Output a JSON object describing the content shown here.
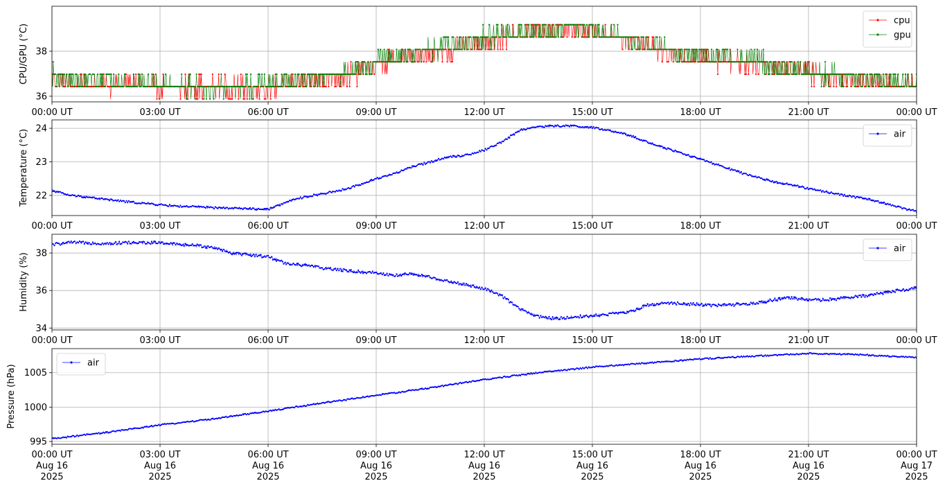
{
  "chart_data": [
    {
      "type": "line",
      "ylabel": "CPU/GPU (°C)",
      "ylim": [
        35.75,
        40.0
      ],
      "yticks": [
        36,
        38
      ],
      "xlabels": [
        "00:00 UT",
        "03:00 UT",
        "06:00 UT",
        "09:00 UT",
        "12:00 UT",
        "15:00 UT",
        "18:00 UT",
        "21:00 UT",
        "00:00 UT"
      ],
      "xlim_hours": [
        0,
        24
      ],
      "grid": true,
      "legend": "top-right",
      "series": [
        {
          "name": "cpu",
          "color": "#ff0000",
          "x_hours": [
            0,
            0.5,
            1,
            1.5,
            2,
            2.5,
            3,
            3.5,
            4,
            4.5,
            5,
            5.5,
            6,
            6.5,
            7,
            7.5,
            8,
            8.5,
            9,
            9.5,
            10,
            10.5,
            11,
            11.5,
            12,
            12.5,
            13,
            13.5,
            14,
            14.5,
            15,
            15.5,
            16,
            16.5,
            17,
            17.5,
            18,
            18.5,
            19,
            19.5,
            20,
            20.5,
            21,
            21.5,
            22,
            22.5,
            23,
            23.5,
            24
          ],
          "values": [
            36.9,
            36.5,
            36.5,
            36.5,
            36.5,
            36.5,
            36.4,
            36.4,
            36.4,
            36.4,
            36.4,
            36.4,
            36.4,
            36.5,
            36.6,
            36.8,
            36.9,
            37.0,
            37.4,
            37.6,
            37.7,
            37.9,
            38.0,
            38.2,
            38.4,
            38.6,
            38.8,
            38.9,
            39.0,
            39.0,
            38.9,
            38.7,
            38.5,
            38.2,
            38.0,
            37.8,
            37.7,
            37.6,
            37.5,
            37.5,
            37.3,
            37.2,
            37.0,
            36.9,
            36.8,
            36.7,
            36.6,
            36.5,
            36.5
          ],
          "noise": 0.35
        },
        {
          "name": "gpu",
          "color": "#008000",
          "x_hours": [
            0,
            0.5,
            1,
            1.5,
            2,
            2.5,
            3,
            3.5,
            4,
            4.5,
            5,
            5.5,
            6,
            6.5,
            7,
            7.5,
            8,
            8.5,
            9,
            9.5,
            10,
            10.5,
            11,
            11.5,
            12,
            12.5,
            13,
            13.5,
            14,
            14.5,
            15,
            15.5,
            16,
            16.5,
            17,
            17.5,
            18,
            18.5,
            19,
            19.5,
            20,
            20.5,
            21,
            21.5,
            22,
            22.5,
            23,
            23.5,
            24
          ],
          "values": [
            37.0,
            36.7,
            36.7,
            36.7,
            36.6,
            36.5,
            36.5,
            36.5,
            36.4,
            36.4,
            36.4,
            36.4,
            36.5,
            36.6,
            36.8,
            36.9,
            37.0,
            37.1,
            37.6,
            37.8,
            38.0,
            38.1,
            38.2,
            38.4,
            38.6,
            38.7,
            38.9,
            39.0,
            39.1,
            39.1,
            39.0,
            38.8,
            38.6,
            38.3,
            38.1,
            37.9,
            37.8,
            37.7,
            37.6,
            37.6,
            37.4,
            37.3,
            37.1,
            37.0,
            36.9,
            36.8,
            36.7,
            36.6,
            36.5
          ],
          "noise": 0.35
        }
      ]
    },
    {
      "type": "line",
      "ylabel": "Temperature (°C)",
      "ylim": [
        21.4,
        24.25
      ],
      "yticks": [
        22,
        23,
        24
      ],
      "xlabels": [
        "00:00 UT",
        "03:00 UT",
        "06:00 UT",
        "09:00 UT",
        "12:00 UT",
        "15:00 UT",
        "18:00 UT",
        "21:00 UT",
        "00:00 UT"
      ],
      "xlim_hours": [
        0,
        24
      ],
      "grid": true,
      "legend": "top-right",
      "series": [
        {
          "name": "air",
          "color": "#0000ff",
          "x_hours": [
            0,
            0.5,
            1,
            1.5,
            2,
            2.5,
            3,
            3.5,
            4,
            4.5,
            5,
            5.5,
            6,
            6.5,
            7,
            7.5,
            8,
            8.5,
            9,
            9.5,
            10,
            10.5,
            11,
            11.5,
            12,
            12.5,
            13,
            13.5,
            14,
            14.5,
            15,
            15.5,
            16,
            16.5,
            17,
            17.5,
            18,
            18.5,
            19,
            19.5,
            20,
            20.5,
            21,
            21.5,
            22,
            22.5,
            23,
            23.5,
            24
          ],
          "values": [
            22.15,
            22.0,
            21.95,
            21.88,
            21.82,
            21.77,
            21.72,
            21.68,
            21.66,
            21.63,
            21.62,
            21.6,
            21.58,
            21.8,
            21.95,
            22.05,
            22.15,
            22.3,
            22.5,
            22.65,
            22.85,
            23.0,
            23.15,
            23.2,
            23.35,
            23.6,
            23.95,
            24.05,
            24.07,
            24.07,
            24.02,
            23.92,
            23.8,
            23.6,
            23.42,
            23.25,
            23.08,
            22.9,
            22.72,
            22.55,
            22.42,
            22.32,
            22.2,
            22.1,
            22.0,
            21.92,
            21.8,
            21.65,
            21.52
          ],
          "noise": 0.03
        }
      ]
    },
    {
      "type": "line",
      "ylabel": "Humidity (%)",
      "ylim": [
        33.9,
        39.0
      ],
      "yticks": [
        34,
        36,
        38
      ],
      "xlabels": [
        "00:00 UT",
        "03:00 UT",
        "06:00 UT",
        "09:00 UT",
        "12:00 UT",
        "15:00 UT",
        "18:00 UT",
        "21:00 UT",
        "00:00 UT"
      ],
      "xlim_hours": [
        0,
        24
      ],
      "grid": true,
      "legend": "top-right",
      "series": [
        {
          "name": "air",
          "color": "#0000ff",
          "x_hours": [
            0,
            0.5,
            1,
            1.5,
            2,
            2.5,
            3,
            3.5,
            4,
            4.5,
            5,
            5.5,
            6,
            6.5,
            7,
            7.5,
            8,
            8.5,
            9,
            9.5,
            10,
            10.5,
            11,
            11.5,
            12,
            12.5,
            13,
            13.5,
            14,
            14.5,
            15,
            15.5,
            16,
            16.5,
            17,
            17.5,
            18,
            18.5,
            19,
            19.5,
            20,
            20.5,
            21,
            21.5,
            22,
            22.5,
            23,
            23.5,
            24
          ],
          "values": [
            38.45,
            38.55,
            38.55,
            38.5,
            38.55,
            38.55,
            38.55,
            38.45,
            38.4,
            38.3,
            38.0,
            37.9,
            37.8,
            37.45,
            37.35,
            37.2,
            37.1,
            37.0,
            36.95,
            36.8,
            36.9,
            36.7,
            36.5,
            36.3,
            36.1,
            35.7,
            35.0,
            34.6,
            34.5,
            34.6,
            34.65,
            34.75,
            34.85,
            35.2,
            35.35,
            35.3,
            35.25,
            35.2,
            35.25,
            35.3,
            35.5,
            35.6,
            35.5,
            35.5,
            35.6,
            35.7,
            35.85,
            36.0,
            36.15
          ],
          "noise": 0.08
        }
      ]
    },
    {
      "type": "line",
      "ylabel": "Pressure (hPa)",
      "ylim": [
        994.6,
        1008.5
      ],
      "yticks": [
        995,
        1000,
        1005
      ],
      "xlabels": [
        "00:00 UT\nAug 16\n2025",
        "03:00 UT\nAug 16\n2025",
        "06:00 UT\nAug 16\n2025",
        "09:00 UT\nAug 16\n2025",
        "12:00 UT\nAug 16\n2025",
        "15:00 UT\nAug 16\n2025",
        "18:00 UT\nAug 16\n2025",
        "21:00 UT\nAug 16\n2025",
        "00:00 UT\nAug 17\n2025"
      ],
      "xlim_hours": [
        0,
        24
      ],
      "grid": true,
      "legend": "top-left",
      "series": [
        {
          "name": "air",
          "color": "#0000ff",
          "x_hours": [
            0,
            1.5,
            3,
            4.5,
            6,
            7.5,
            9,
            10.5,
            12,
            13.5,
            15,
            16.5,
            18,
            19.5,
            21,
            22.5,
            24
          ],
          "values": [
            995.4,
            996.3,
            997.4,
            998.3,
            999.4,
            1000.6,
            1001.7,
            1002.8,
            1004.0,
            1005.0,
            1005.8,
            1006.4,
            1007.0,
            1007.4,
            1007.8,
            1007.6,
            1007.2
          ],
          "noise": 0.1
        }
      ]
    }
  ]
}
